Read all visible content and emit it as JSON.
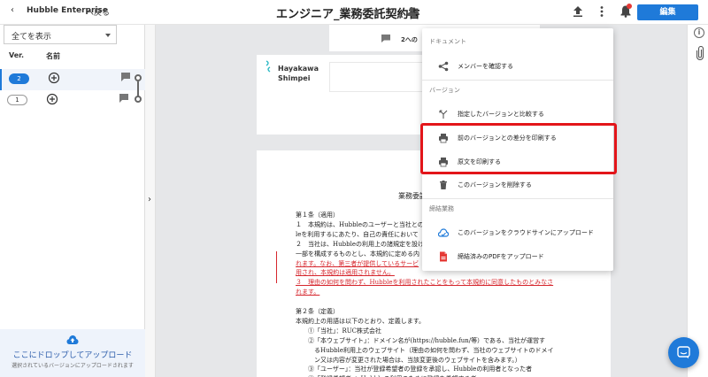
{
  "topbar": {
    "brand": "Hubble Enterprise",
    "back_label": "へ戻る",
    "doc_title": "エンジニア_業務委託契約書",
    "edit_button": "編集"
  },
  "sidebar": {
    "filter_value": "全てを表示",
    "col_version": "Ver.",
    "col_name": "名前",
    "versions": [
      {
        "number": "2",
        "active": true
      },
      {
        "number": "1",
        "active": false
      }
    ],
    "dropzone_title": "ここにドロップしてアップロード",
    "dropzone_sub": "選択されているバージョンにアップロードされます"
  },
  "comment_bar": {
    "text": "2への"
  },
  "user": {
    "first": "Hayakawa",
    "last": "Shimpei"
  },
  "document": {
    "title": "業務委託",
    "lines": [
      {
        "text": "第１条（適用）",
        "red": false
      },
      {
        "text": "１　本規約は、Hubbleのユーザーと当社との",
        "red": false
      },
      {
        "text": "leを利用するにあたり、自己の責任において",
        "red": false
      },
      {
        "text": "２　当社は、Hubbleの利用上の諸規定を設け",
        "red": false
      },
      {
        "text": "一部を構成するものとし、本規約に定める内",
        "red": false
      },
      {
        "text": "れます。なお、第三者が提供しているサービ",
        "red": true
      },
      {
        "text": "用され、本規約は適用されません。",
        "red": true
      },
      {
        "text": "３　理由の如何を問わず、Hubbleを利用されたことをもって本規約に同意したものとみなさ",
        "red": true
      },
      {
        "text": "れます。",
        "red": true
      },
      {
        "text": "",
        "red": false
      },
      {
        "text": "第２条（定義）",
        "red": false
      },
      {
        "text": "本規約上の用語は以下のとおり、定義します。",
        "red": false
      },
      {
        "text": "　　①「当社」：RUC株式会社",
        "red": false
      },
      {
        "text": "　　②「本ウェブサイト」：ドメイン名が(https://hubble.fun/等）である、当社が運営す",
        "red": false
      },
      {
        "text": "　　　るHubble利用上のウェブサイト（理由の如何を問わず、当社のウェブサイトのドメイ",
        "red": false
      },
      {
        "text": "　　　ン又は内容が変更された場合は、当該変更後のウェブサイトを含みます。）",
        "red": false
      },
      {
        "text": "　　③「ユーザー」：当社が登録希望者の登録を承認し、Hubbleの利用者となった者",
        "red": false
      },
      {
        "text": "　　④「登録希望者」：Hubbleの利用のために登録を希望する者",
        "red": false
      }
    ]
  },
  "menu": {
    "section_document": "ドキュメント",
    "section_version": "バージョン",
    "section_contract": "締結業務",
    "items": {
      "members": "メンバーを確認する",
      "compare": "指定したバージョンと比較する",
      "print_diff": "前のバージョンとの差分を印刷する",
      "print_original": "原文を印刷する",
      "delete_version": "このバージョンを削除する",
      "upload_cloudsign": "このバージョンをクラウドサインにアップロード",
      "upload_pdf": "締結済みのPDFをアップロード"
    }
  },
  "colors": {
    "accent": "#1f7ad9",
    "highlight_border": "#e3151a",
    "diff_red": "#d6262d"
  }
}
